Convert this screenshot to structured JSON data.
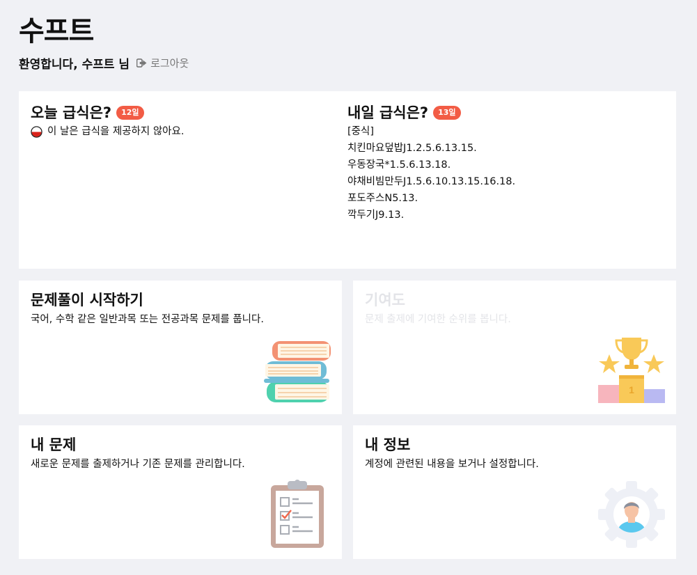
{
  "header": {
    "brand": "수프트",
    "welcome": "환영합니다, 수프트 님",
    "logout_label": "로그아웃"
  },
  "meal": {
    "today": {
      "title": "오늘 급식은?",
      "badge": "12일",
      "message": "이 날은 급식을 제공하지 않아요."
    },
    "tomorrow": {
      "title": "내일 급식은?",
      "badge": "13일",
      "items": [
        "[중식]",
        "치킨마요덮밥J1.2.5.6.13.15.",
        "우동장국*1.5.6.13.18.",
        "야채비빔만두J1.5.6.10.13.15.16.18.",
        "포도주스N5.13.",
        "깍두기J9.13."
      ]
    }
  },
  "tiles": {
    "solve": {
      "title": "문제풀이 시작하기",
      "desc": "국어, 수학 같은 일반과목 또는 전공과목 문제를 풉니다.",
      "icon": "books-icon"
    },
    "contrib": {
      "title": "기여도",
      "desc": "문제 출제에 기여한 순위를 봅니다.",
      "icon": "trophy-podium-icon"
    },
    "myq": {
      "title": "내 문제",
      "desc": "새로운 문제를 출제하거나 기존 문제를 관리합니다.",
      "icon": "clipboard-checklist-icon"
    },
    "myinfo": {
      "title": "내 정보",
      "desc": "계정에 관련된 내용을 보거나 설정합니다.",
      "icon": "user-gear-icon"
    }
  },
  "colors": {
    "background": "#f0f1f5",
    "badge": "#f25c45",
    "disabled_text": "#e3e4e8"
  }
}
